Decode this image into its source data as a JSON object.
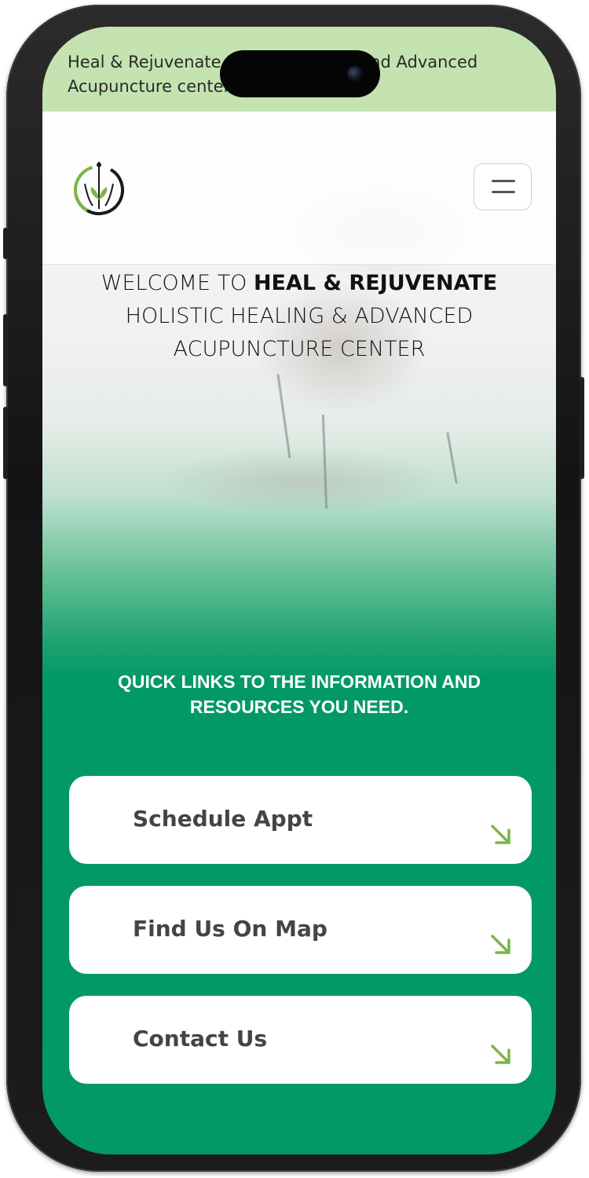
{
  "banner": {
    "text": "Heal & Rejuvenate Holistic Healing and Advanced Acupuncture center"
  },
  "header": {
    "logo_icon": "acupuncture-body-leaf-logo",
    "menu_icon": "hamburger-icon"
  },
  "hero": {
    "line1_prefix": "WELCOME TO ",
    "line1_brand": "HEAL & REJUVENATE",
    "line2": "HOLISTIC HEALING & ADVANCED",
    "line3": "ACUPUNCTURE CENTER"
  },
  "quick_links": {
    "heading_line1": "QUICK LINKS TO THE INFORMATION AND",
    "heading_line2": "RESOURCES YOU NEED.",
    "items": [
      {
        "label": "Schedule Appt",
        "icon": "arrow-down-right-icon"
      },
      {
        "label": "Find Us On Map",
        "icon": "arrow-down-right-icon"
      },
      {
        "label": "Contact Us",
        "icon": "arrow-down-right-icon"
      }
    ]
  },
  "colors": {
    "banner_bg": "#c4e3b0",
    "brand_green": "#039966",
    "arrow_green": "#7ab648",
    "card_text": "#444448"
  }
}
